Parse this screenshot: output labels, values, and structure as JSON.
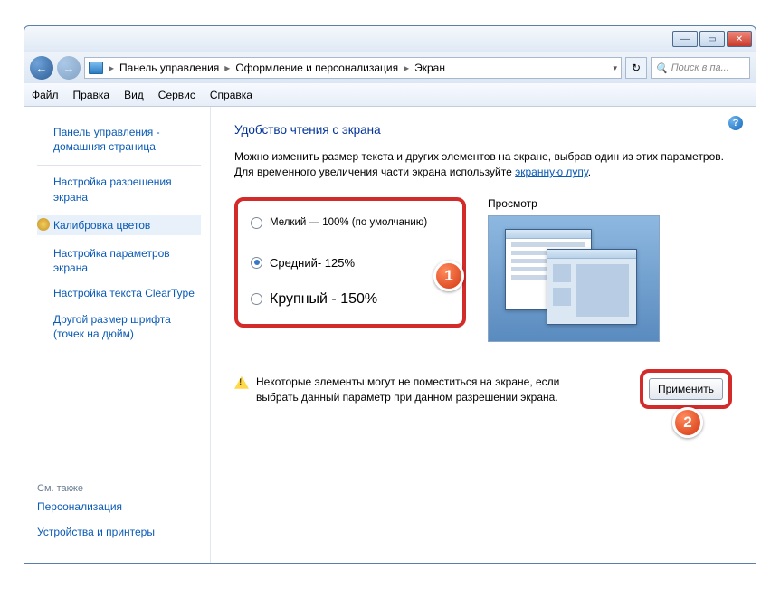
{
  "window": {
    "minimize": "—",
    "maximize": "▭",
    "close": "✕"
  },
  "breadcrumb": {
    "root_sep": "▸",
    "item1": "Панель управления",
    "item2": "Оформление и персонализация",
    "item3": "Экран"
  },
  "search": {
    "placeholder": "Поиск в па..."
  },
  "menu": {
    "file": "Файл",
    "edit": "Правка",
    "view": "Вид",
    "service": "Сервис",
    "help": "Справка"
  },
  "sidebar": {
    "home": "Панель управления - домашняя страница",
    "resolution": "Настройка разрешения экрана",
    "calibrate": "Калибровка цветов",
    "params": "Настройка параметров экрана",
    "cleartype": "Настройка текста ClearType",
    "dpi": "Другой размер шрифта (точек на дюйм)",
    "see_also": "См. также",
    "personalization": "Персонализация",
    "devices": "Устройства и принтеры"
  },
  "main": {
    "title": "Удобство чтения с экрана",
    "desc_a": "Можно изменить размер текста и других элементов на экране, выбрав один из этих параметров. Для временного увеличения части экрана используйте ",
    "desc_link": "экранную лупу",
    "desc_b": ".",
    "opt_small": "Мелкий — 100% (по умолчанию)",
    "opt_med": "Средний- 125%",
    "opt_large": "Крупный - 150%",
    "preview_label": "Просмотр",
    "warning": "Некоторые элементы могут не поместиться на экране, если выбрать данный параметр при данном разрешении экрана.",
    "apply": "Применить"
  },
  "badges": {
    "one": "1",
    "two": "2"
  }
}
